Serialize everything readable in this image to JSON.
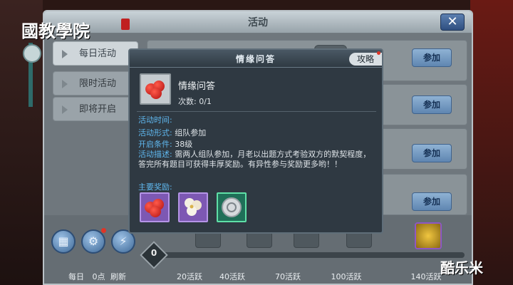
{
  "watermark": {
    "top_left": "國教學院",
    "bottom_right": "酷乐米"
  },
  "window": {
    "title": "活动",
    "close_glyph": "✕"
  },
  "sidebar": {
    "items": [
      {
        "label": "每日活动",
        "active": true
      },
      {
        "label": "限时活动",
        "active": false
      },
      {
        "label": "即将开启",
        "active": false
      }
    ]
  },
  "list": {
    "join_label": "参加",
    "rows": 4
  },
  "bottom_bar": {
    "daily_label": "每日",
    "points_text": "0点",
    "refresh_label": "刷新",
    "points_value": "0",
    "milestones": [
      "20活跃",
      "40活跃",
      "70活跃",
      "100活跃",
      "140活跃"
    ]
  },
  "modal": {
    "title": "情缘问答",
    "guide_label": "攻略",
    "activity_name": "情缘问答",
    "count_label": "次数: 0/1",
    "time_key": "活动时间:",
    "time_value": "",
    "form_key": "活动形式:",
    "form_value": "组队参加",
    "req_key": "开启条件:",
    "req_value": "38级",
    "desc_key": "活动描述:",
    "desc_value": "需两人组队参加，月老以出题方式考验双方的默契程度，答完所有题目可获得丰厚奖励。有异性参与奖励更多哟！！",
    "reward_title": "主要奖励:",
    "rewards": [
      {
        "icon": "rose-icon",
        "rarity": "purple"
      },
      {
        "icon": "flower-bouquet-icon",
        "rarity": "purple"
      },
      {
        "icon": "silver-coin-icon",
        "rarity": "green"
      }
    ]
  },
  "colors": {
    "accent_blue": "#5fb8ef",
    "button_blue": "#5f86b1",
    "notification_red": "#e03426",
    "rarity_purple": "#7d58b3",
    "rarity_green": "#1f6f58"
  }
}
